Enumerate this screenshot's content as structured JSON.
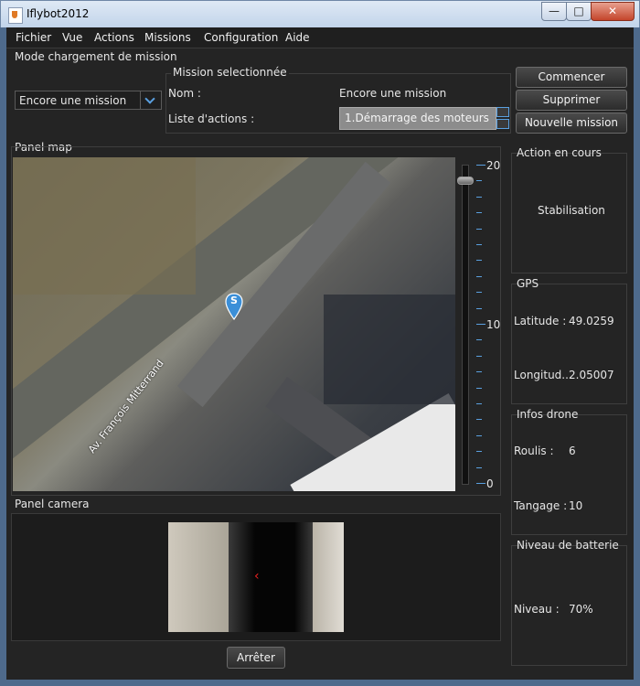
{
  "window": {
    "title": "Iflybot2012",
    "minimize": "—",
    "maximize": "□",
    "close": "✕"
  },
  "menu": {
    "items": [
      "Fichier",
      "Vue",
      "Actions",
      "Missions",
      "Configuration",
      "Aide"
    ]
  },
  "mission_mode": {
    "label": "Mode chargement de mission",
    "combo_value": "Encore une mission"
  },
  "mission_selected": {
    "label": "Mission selectionnée",
    "name_label": "Nom :",
    "name_value": "Encore une mission",
    "actions_label": "Liste d'actions :",
    "actions_value": "1.Démarrage des moteurs"
  },
  "buttons": {
    "start": "Commencer",
    "delete": "Supprimer",
    "new_mission": "Nouvelle mission",
    "stop": "Arrêter"
  },
  "map_panel": {
    "label": "Panel map",
    "street_label": "Av. François Mitterrand",
    "marker_letter": "S",
    "slider_max": "20",
    "slider_mid": "10",
    "slider_min": "0",
    "zoom_level": 20
  },
  "camera_panel": {
    "label": "Panel camera"
  },
  "current_action": {
    "label": "Action en cours",
    "value": "Stabilisation"
  },
  "gps": {
    "label": "GPS",
    "latitude_label": "Latitude :",
    "latitude_value": "49.0259",
    "longitude_label": "Longitud...",
    "longitude_value": "2.05007"
  },
  "drone_info": {
    "label": "Infos drone",
    "roll_label": "Roulis :",
    "roll_value": "6",
    "pitch_label": "Tangage :",
    "pitch_value": "10"
  },
  "battery": {
    "label": "Niveau de batterie",
    "level_label": "Niveau :",
    "level_value": "70%"
  },
  "colors": {
    "accent": "#5aa0e0",
    "marker": "#3b8fd8",
    "background": "#242424"
  }
}
